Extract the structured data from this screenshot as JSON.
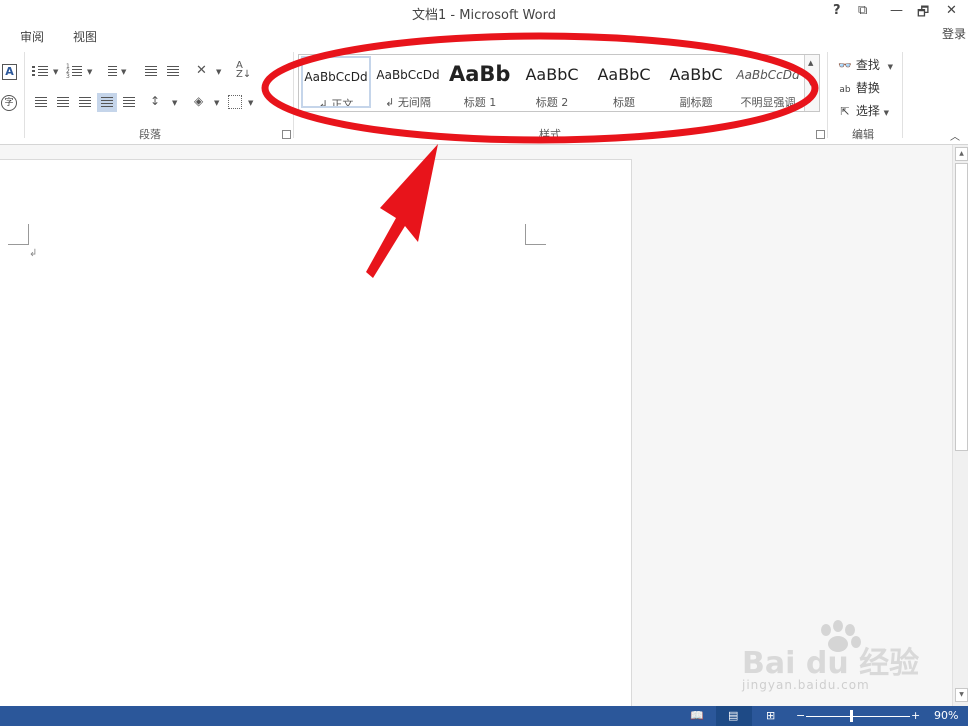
{
  "window": {
    "title": "文档1 - Microsoft Word",
    "help": "?",
    "restore_ribbon": "⧉",
    "minimize": "—",
    "maximize": "🗗",
    "close": "✕",
    "login": "登录"
  },
  "tabs": [
    "审阅",
    "视图"
  ],
  "ribbon": {
    "paragraph_group": "段落",
    "styles_group": "样式",
    "editing_group": "编辑",
    "styles": [
      {
        "sample": "AaBbCcDd",
        "name": "↲ 正文"
      },
      {
        "sample": "AaBbCcDd",
        "name": "↲ 无间隔"
      },
      {
        "sample": "AaBb",
        "name": "标题 1"
      },
      {
        "sample": "AaBbC",
        "name": "标题 2"
      },
      {
        "sample": "AaBbC",
        "name": "标题"
      },
      {
        "sample": "AaBbC",
        "name": "副标题"
      },
      {
        "sample": "AaBbCcDd",
        "name": "不明显强调"
      }
    ],
    "editing": {
      "find": "查找",
      "replace": "替换",
      "select": "选择"
    }
  },
  "status": {
    "zoom": "90%",
    "zoom_minus": "−",
    "zoom_plus": "+"
  },
  "colors": {
    "status_bar": "#2b579a",
    "annotation_red": "#e8141b"
  },
  "watermark": {
    "brand": "Bai du 经验",
    "url": "jingyan.baidu.com"
  }
}
